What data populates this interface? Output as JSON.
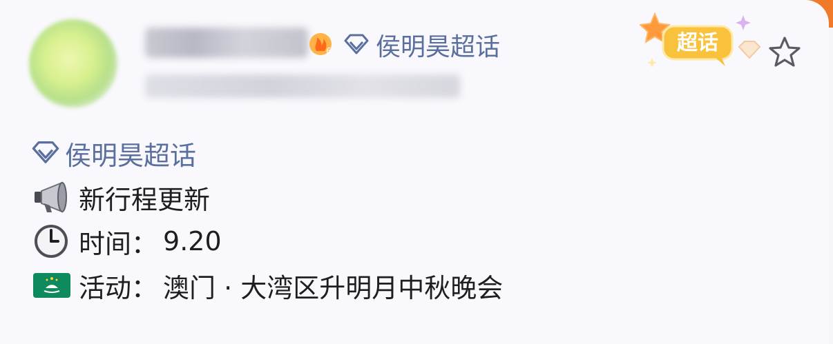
{
  "header": {
    "topic_label": "侯明昊超话",
    "badge_text": "超话",
    "level_number": "6"
  },
  "post": {
    "topic_tag": "侯明昊超话",
    "title": "新行程更新",
    "time_label": "时间：",
    "time_value": "9.20",
    "event_label": "活动：",
    "event_value": "澳门 · 大湾区升明月中秋晚会"
  },
  "icons": {
    "topic": "diamond-icon",
    "favorite": "star-outline-icon",
    "announce": "megaphone-emoji",
    "time": "clock-emoji",
    "flag": "macau-flag-emoji"
  },
  "colors": {
    "topic_text": "#5a6f9e",
    "body_text": "#1e1e22",
    "badge_orange": "#f5a623",
    "frame_accent": "#f07a2a"
  }
}
